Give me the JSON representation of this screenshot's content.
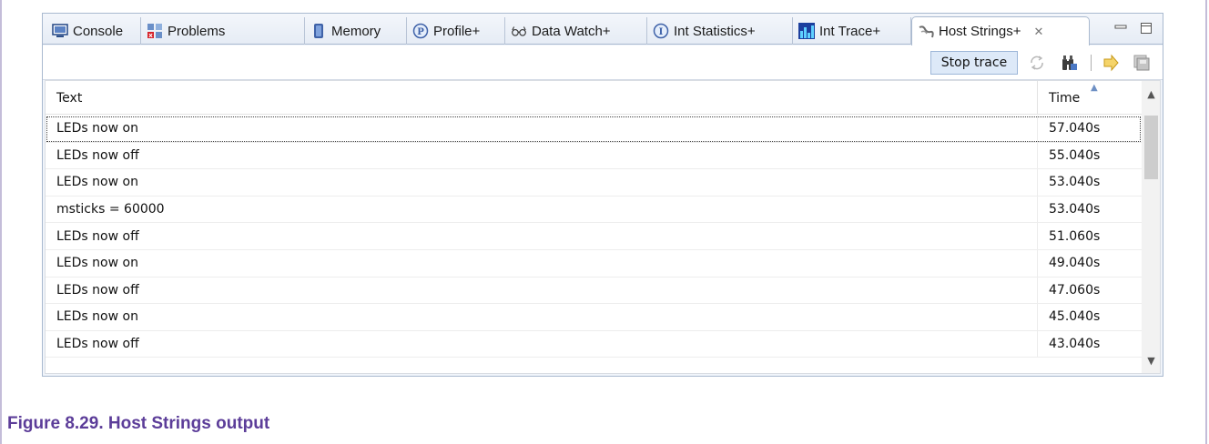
{
  "tabs": [
    {
      "label": "Console",
      "icon": "console-icon",
      "active": false
    },
    {
      "label": "Problems",
      "icon": "problems-icon",
      "active": false
    },
    {
      "label": "Memory",
      "icon": "memory-icon",
      "active": false
    },
    {
      "label": "Profile+",
      "icon": "profile-icon",
      "active": false
    },
    {
      "label": "Data Watch+",
      "icon": "glasses-icon",
      "active": false
    },
    {
      "label": "Int Statistics+",
      "icon": "info-icon",
      "active": false
    },
    {
      "label": "Int Trace+",
      "icon": "bar-chart-icon",
      "active": false
    },
    {
      "label": "Host Strings+",
      "icon": "host-strings-icon",
      "active": true
    }
  ],
  "close_glyph": "✕",
  "toolbar": {
    "stop_trace_label": "Stop trace",
    "icons": [
      "refresh-icon",
      "find-icon",
      "arrow-icon",
      "save-icon"
    ]
  },
  "table": {
    "columns": {
      "text": "Text",
      "time": "Time"
    },
    "sort_glyph": "▲",
    "scroll_up_glyph": "▲",
    "scroll_down_glyph": "▼",
    "rows": [
      {
        "text": "LEDs now on",
        "time": "57.040s"
      },
      {
        "text": "LEDs now off",
        "time": "55.040s"
      },
      {
        "text": "LEDs now on",
        "time": "53.040s"
      },
      {
        "text": "msticks = 60000",
        "time": "53.040s"
      },
      {
        "text": "LEDs now off",
        "time": "51.060s"
      },
      {
        "text": "LEDs now on",
        "time": "49.040s"
      },
      {
        "text": "LEDs now off",
        "time": "47.060s"
      },
      {
        "text": "LEDs now on",
        "time": "45.040s"
      },
      {
        "text": "LEDs now off",
        "time": "43.040s"
      }
    ]
  },
  "caption": "Figure 8.29. Host Strings output"
}
